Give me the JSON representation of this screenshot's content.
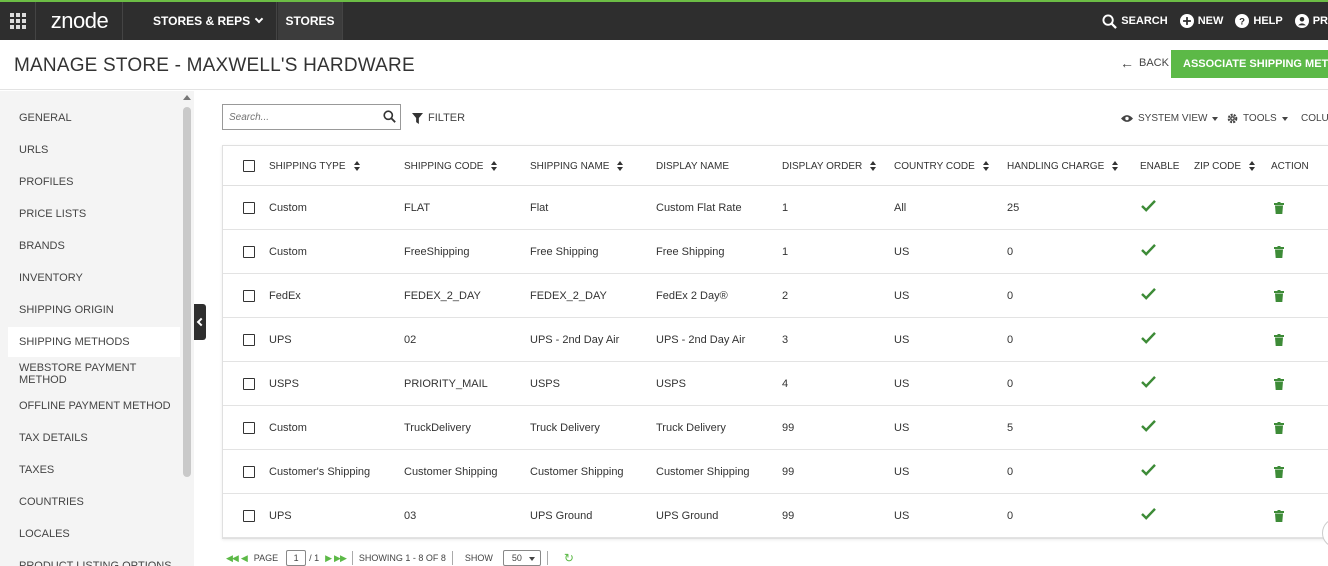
{
  "topbar": {
    "logo": "znode",
    "menu": [
      "STORES & REPS",
      "STORES"
    ],
    "search": "SEARCH",
    "new": "NEW",
    "help": "HELP",
    "profile": "PR"
  },
  "header": {
    "title": "MANAGE STORE - MAXWELL'S HARDWARE",
    "back": "BACK",
    "associate_button": "ASSOCIATE SHIPPING METHO"
  },
  "sidebar": {
    "items": [
      "GENERAL",
      "URLS",
      "PROFILES",
      "PRICE LISTS",
      "BRANDS",
      "INVENTORY",
      "SHIPPING ORIGIN",
      "SHIPPING METHODS",
      "WEBSTORE PAYMENT METHOD",
      "OFFLINE PAYMENT METHOD",
      "TAX DETAILS",
      "TAXES",
      "COUNTRIES",
      "LOCALES",
      "PRODUCT LISTING OPTIONS"
    ],
    "active": "SHIPPING METHODS"
  },
  "toolbar": {
    "search_placeholder": "Search...",
    "filter": "FILTER",
    "system_view": "SYSTEM VIEW",
    "tools": "TOOLS",
    "columns": "COLUM"
  },
  "table": {
    "columns": [
      "SHIPPING TYPE",
      "SHIPPING CODE",
      "SHIPPING NAME",
      "DISPLAY NAME",
      "DISPLAY ORDER",
      "COUNTRY CODE",
      "HANDLING CHARGE",
      "ENABLE",
      "ZIP CODE",
      "ACTION"
    ],
    "rows": [
      {
        "type": "Custom",
        "code": "FLAT",
        "name": "Flat",
        "display": "Custom Flat Rate",
        "order": "1",
        "country": "All",
        "handling": "25",
        "enabled": true,
        "zip": ""
      },
      {
        "type": "Custom",
        "code": "FreeShipping",
        "name": "Free Shipping",
        "display": "Free Shipping",
        "order": "1",
        "country": "US",
        "handling": "0",
        "enabled": true,
        "zip": ""
      },
      {
        "type": "FedEx",
        "code": "FEDEX_2_DAY",
        "name": "FEDEX_2_DAY",
        "display": "FedEx 2 Day®",
        "order": "2",
        "country": "US",
        "handling": "0",
        "enabled": true,
        "zip": ""
      },
      {
        "type": "UPS",
        "code": "02",
        "name": "UPS - 2nd Day Air",
        "display": "UPS - 2nd Day Air",
        "order": "3",
        "country": "US",
        "handling": "0",
        "enabled": true,
        "zip": ""
      },
      {
        "type": "USPS",
        "code": "PRIORITY_MAIL",
        "name": "USPS",
        "display": "USPS",
        "order": "4",
        "country": "US",
        "handling": "0",
        "enabled": true,
        "zip": ""
      },
      {
        "type": "Custom",
        "code": "TruckDelivery",
        "name": "Truck Delivery",
        "display": "Truck Delivery",
        "order": "99",
        "country": "US",
        "handling": "5",
        "enabled": true,
        "zip": ""
      },
      {
        "type": "Customer's Shipping",
        "code": "Customer Shipping",
        "name": "Customer Shipping",
        "display": "Customer Shipping",
        "order": "99",
        "country": "US",
        "handling": "0",
        "enabled": true,
        "zip": ""
      },
      {
        "type": "UPS",
        "code": "03",
        "name": "UPS Ground",
        "display": "UPS Ground",
        "order": "99",
        "country": "US",
        "handling": "0",
        "enabled": true,
        "zip": ""
      }
    ]
  },
  "pager": {
    "page_label": "PAGE",
    "page": "1",
    "total_pages": "/ 1",
    "showing": "SHOWING 1 - 8 OF 8",
    "show_label": "SHOW",
    "page_size": "50"
  },
  "colors": {
    "accent": "#5cb947",
    "topbar": "#2e2e2e",
    "check": "#3d8b37",
    "trash": "#3d8b37"
  },
  "icons": [
    "apps-grid-icon",
    "chevron-down-icon",
    "search-icon",
    "plus-circle-icon",
    "help-circle-icon",
    "user-icon",
    "arrow-left-icon",
    "filter-icon",
    "eye-icon",
    "gear-icon",
    "check-icon",
    "trash-icon",
    "refresh-icon"
  ]
}
